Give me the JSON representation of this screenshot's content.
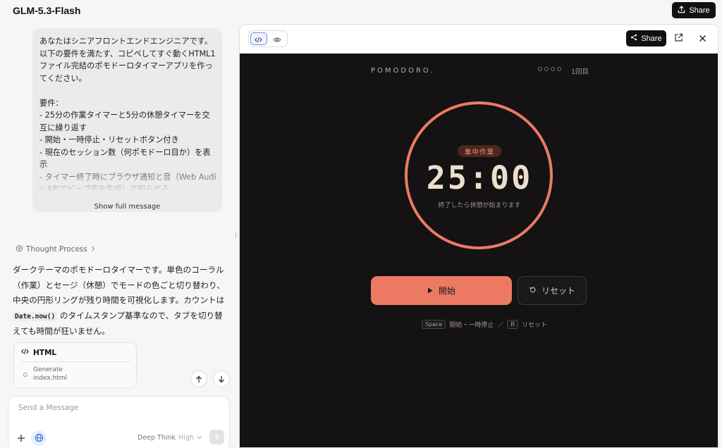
{
  "app": {
    "title": "GLM-5.3-Flash",
    "share_label": "Share"
  },
  "chat": {
    "user_message": "あなたはシニアフロントエンドエンジニアです。以下の要件を満たす、コピペしてすぐ動くHTML1ファイル完結のポモドーロタイマーアプリを作ってください。\n\n要件：\n- 25分の作業タイマーと5分の休憩タイマーを交互に繰り返す\n- 開始・一時停止・リセットボタン付き\n- 現在のセッション数（何ポモドーロ目か）を表示\n- タイマー終了時にブラウザ通知と音（Web Audio APIでビープ音を生成）で知らせる",
    "show_full_label": "Show full message",
    "thought_label": "Thought Process",
    "answer_before_code": "ダークテーマのポモドーロタイマーです。単色のコーラル（作業）とセージ（休憩）でモードの色ごと切り替わり、中央の円形リングが残り時間を可視化します。カウントは ",
    "answer_code": "Date.now()",
    "answer_after_code": " のタイムスタンプ基準なので、タブを切り替えても時間が狂いません。",
    "artifact": {
      "title": "HTML",
      "step_line1": "Generate",
      "step_line2": "index.html"
    }
  },
  "composer": {
    "placeholder": "Send a Message",
    "mode_label": "Deep Think",
    "mode_level": "High"
  },
  "preview": {
    "share_label": "Share",
    "brand": "POMODORO.",
    "session_count": "1回目",
    "session_dots_total": 4,
    "mode_badge": "集中作業",
    "timer": "25:00",
    "timer_sub": "終了したら休憩が始まります",
    "start_label": "開始",
    "reset_label": "リセット",
    "shortcut_key1": "Space",
    "shortcut_text1": "開始・一時停止",
    "shortcut_sep": "／",
    "shortcut_key2": "R",
    "shortcut_text2": "リセット"
  },
  "colors": {
    "accent_coral": "#ec7a62",
    "stage_bg": "#141212",
    "timer_text": "#ecdfcc"
  }
}
